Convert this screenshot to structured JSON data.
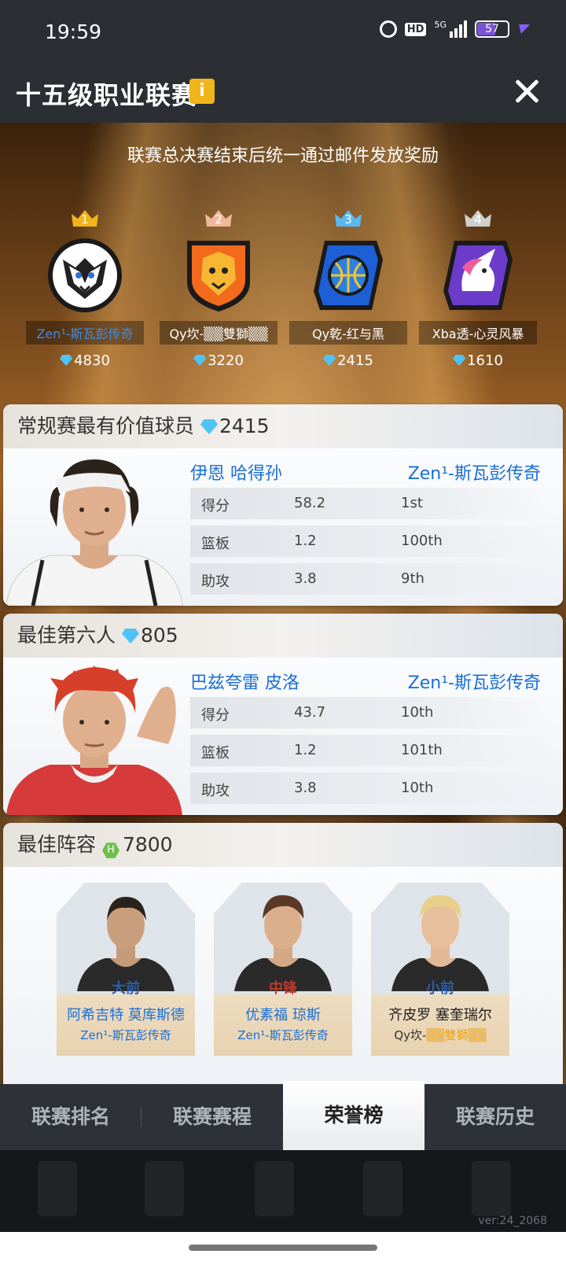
{
  "status_bar": {
    "time": "19:59",
    "hd": "HD",
    "network": "5G",
    "battery": "57"
  },
  "header": {
    "title": "十五级职业联赛",
    "info": "i"
  },
  "notice": "联赛总决赛结束后统一通过邮件发放奖励",
  "teams": [
    {
      "rank": "1",
      "name": "Zen¹-斯瓦彭传奇",
      "score": "4830",
      "crown_color": "#f2b41b",
      "logo": "tiger-logo-icon"
    },
    {
      "rank": "2",
      "name": "Qy坎-▒▒雙獅▒▒",
      "score": "3220",
      "crown_color": "#f0b89a",
      "logo": "lion-shield-logo-icon"
    },
    {
      "rank": "3",
      "name": "Qy乾-红与黑",
      "score": "2415",
      "crown_color": "#58b8f0",
      "logo": "basketball-logo-icon"
    },
    {
      "rank": "4",
      "name": "Xba透-心灵风暴",
      "score": "1610",
      "crown_color": "#cfcfcf",
      "logo": "unicorn-logo-icon"
    }
  ],
  "mvp": {
    "title": "常规赛最有价值球员",
    "reward": "2415",
    "player_name": "伊恩 哈得孙",
    "team_name": "Zen¹-斯瓦彭传奇",
    "stats": [
      {
        "label": "得分",
        "value": "58.2",
        "rank": "1st"
      },
      {
        "label": "篮板",
        "value": "1.2",
        "rank": "100th"
      },
      {
        "label": "助攻",
        "value": "3.8",
        "rank": "9th"
      }
    ]
  },
  "sixth_man": {
    "title": "最佳第六人",
    "reward": "805",
    "player_name": "巴兹夸雷 皮洛",
    "team_name": "Zen¹-斯瓦彭传奇",
    "stats": [
      {
        "label": "得分",
        "value": "43.7",
        "rank": "10th"
      },
      {
        "label": "篮板",
        "value": "1.2",
        "rank": "101th"
      },
      {
        "label": "助攻",
        "value": "3.8",
        "rank": "10th"
      }
    ]
  },
  "lineup": {
    "title": "最佳阵容",
    "hex_icon": "H",
    "reward": "7800",
    "players": [
      {
        "position": "大前",
        "name": "阿希吉特 莫库斯德",
        "team": "Zen¹-斯瓦彭传奇"
      },
      {
        "position": "中锋",
        "name": "优素福 琼斯",
        "team": "Zen¹-斯瓦彭传奇"
      },
      {
        "position": "小前",
        "name": "齐皮罗 塞奎瑞尔",
        "team_prefix": "Qy坎-",
        "team_highlight": "▒▒雙獅▒▒"
      }
    ]
  },
  "tabs": [
    "联赛排名",
    "联赛赛程",
    "荣誉榜",
    "联赛历史"
  ],
  "active_tab": "荣誉榜",
  "version": "ver:24_2068"
}
